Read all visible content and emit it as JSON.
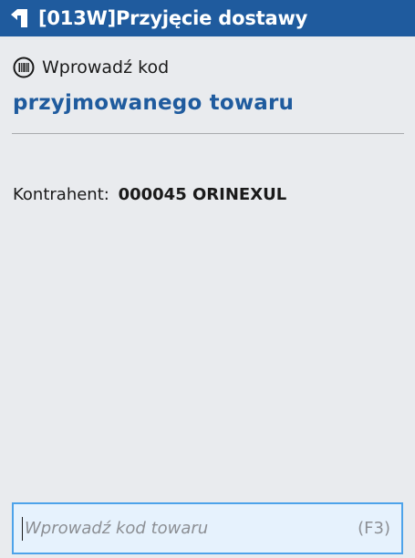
{
  "window": {
    "title": "[013W]Przyjęcie dostawy",
    "back_icon": "back-arrow-icon"
  },
  "prompt": {
    "icon": "barcode-icon",
    "line1": "Wprowadź kod",
    "line2": "przyjmowanego towaru"
  },
  "contractor": {
    "label": "Kontrahent:",
    "value": "000045 ORINEXUL"
  },
  "input": {
    "placeholder": "Wprowadź kod towaru",
    "value": "",
    "shortcut": "(F3)"
  },
  "colors": {
    "titlebar": "#1f5b9e",
    "accent_text": "#1f5b9e",
    "background": "#e9ebee",
    "input_border": "#4da3ea",
    "input_background": "#e6f2fd"
  }
}
